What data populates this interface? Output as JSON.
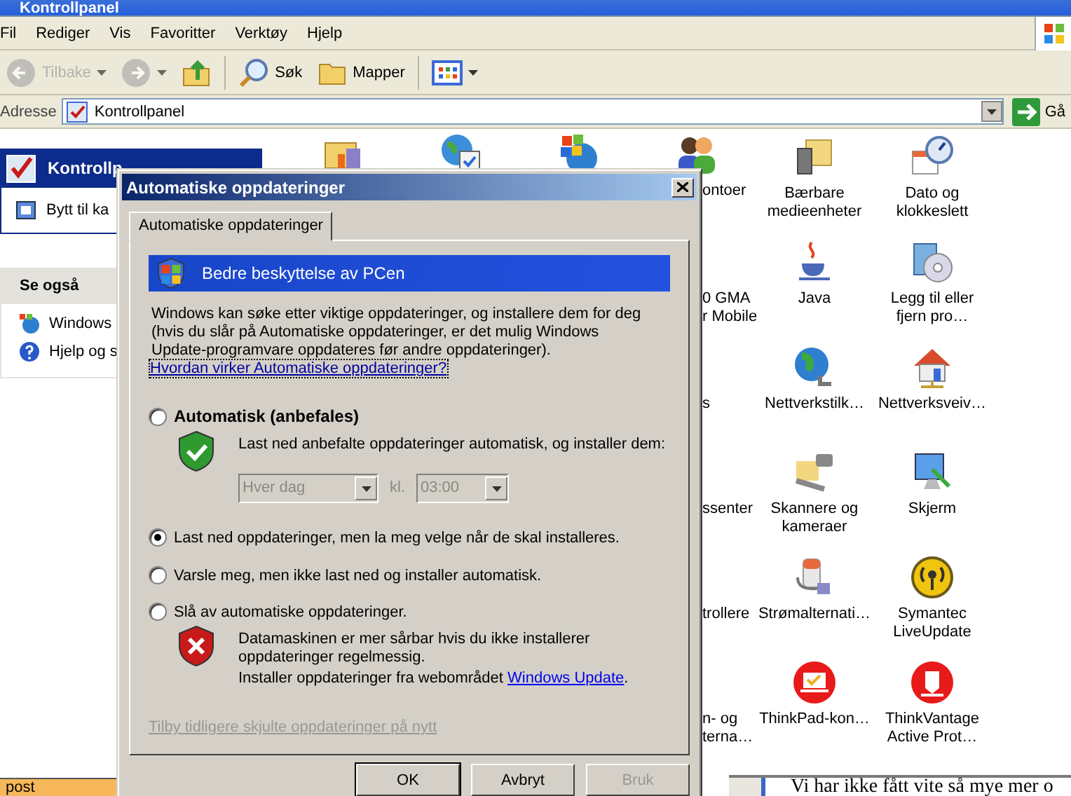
{
  "window": {
    "title": "Kontrollpanel"
  },
  "menu": [
    "Fil",
    "Rediger",
    "Vis",
    "Favoritter",
    "Verktøy",
    "Hjelp"
  ],
  "toolbar": [
    {
      "kind": "back",
      "label": "Tilbake",
      "disabled": true
    },
    {
      "kind": "forward",
      "disabled": true
    },
    {
      "kind": "up",
      "disabled": false
    },
    {
      "kind": "search",
      "label": "Søk",
      "disabled": false
    },
    {
      "kind": "folders",
      "label": "Mapper",
      "disabled": false
    },
    {
      "kind": "views",
      "disabled": false
    }
  ],
  "address": {
    "label": "Adresse",
    "value": "Kontrollpanel",
    "go": "Gå"
  },
  "task_pane": {
    "header": "Kontrollp",
    "link": "Bytt til ka",
    "see_also_title": "Se også",
    "see_also_links": [
      "Windows",
      "Hjelp og s"
    ],
    "footer": "post"
  },
  "partial_column": [
    {
      "lines": [
        "ontoer"
      ]
    },
    {
      "lines": [
        "0 GMA",
        "r Mobile"
      ]
    },
    {
      "lines": [
        "s"
      ]
    },
    {
      "lines": [
        "ssenter"
      ]
    },
    {
      "lines": [
        "trollere"
      ]
    },
    {
      "lines": [
        "n- og",
        "terna…"
      ]
    }
  ],
  "columns": [
    {
      "items": [
        {
          "lines": [
            "Bærbare",
            "medieenheter"
          ]
        },
        {
          "lines": [
            "Java"
          ]
        },
        {
          "lines": [
            "Nettverkstilk…"
          ]
        },
        {
          "lines": [
            "Skannere og",
            "kameraer"
          ]
        },
        {
          "lines": [
            "Strømalternati…"
          ]
        },
        {
          "lines": [
            "ThinkPad-kon…"
          ]
        }
      ]
    },
    {
      "items": [
        {
          "lines": [
            "Dato og",
            "klokkeslett"
          ]
        },
        {
          "lines": [
            "Legg til eller",
            "fjern pro…"
          ]
        },
        {
          "lines": [
            "Nettverksveiv…"
          ]
        },
        {
          "lines": [
            "Skjerm"
          ]
        },
        {
          "lines": [
            "Symantec",
            "LiveUpdate"
          ]
        },
        {
          "lines": [
            "ThinkVantage",
            "Active Prot…"
          ]
        }
      ]
    }
  ],
  "dialog": {
    "title": "Automatiske oppdateringer",
    "tabs": [
      {
        "label": "Automatiske oppdateringer",
        "selected": true
      }
    ],
    "banner": "Bedre beskyttelse av PCen",
    "intro": "Windows kan søke etter viktige oppdateringer, og installere dem for deg (hvis du slår på Automatiske oppdateringer, er det mulig Windows Update-programvare oppdateres før andre oppdateringer).",
    "help_link": "Hvordan virker Automatiske oppdateringer?",
    "options": [
      {
        "kind": "automatic",
        "label": "Automatisk (anbefales)",
        "selected": false,
        "description": "Last ned anbefalte oppdateringer automatisk, og installer dem:",
        "schedule": {
          "day": "Hver dag",
          "at_label": "kl.",
          "time": "03:00",
          "disabled": true
        }
      },
      {
        "kind": "plain",
        "label": "Last ned oppdateringer, men la meg velge når de skal installeres.",
        "selected": true
      },
      {
        "kind": "plain",
        "label": "Varsle meg, men ikke last ned og installer automatisk.",
        "selected": false
      },
      {
        "kind": "off",
        "label": "Slå av automatiske oppdateringer.",
        "selected": false,
        "warning": "Datamaskinen er mer sårbar hvis du ikke installerer oppdateringer regelmessig.",
        "install_text": "Installer oppdateringer fra webområdet",
        "install_link": "Windows Update",
        "install_end": "."
      }
    ],
    "restore_link": {
      "label": "Tilby tidligere skjulte oppdateringer på nytt",
      "disabled": true
    },
    "buttons": [
      {
        "label": "OK",
        "default": true,
        "disabled": false
      },
      {
        "label": "Avbryt",
        "default": false,
        "disabled": false
      },
      {
        "label": "Bruk",
        "default": false,
        "disabled": true
      }
    ]
  },
  "background_window": {
    "text": "Vi har ikke fått vite så mye mer o"
  }
}
